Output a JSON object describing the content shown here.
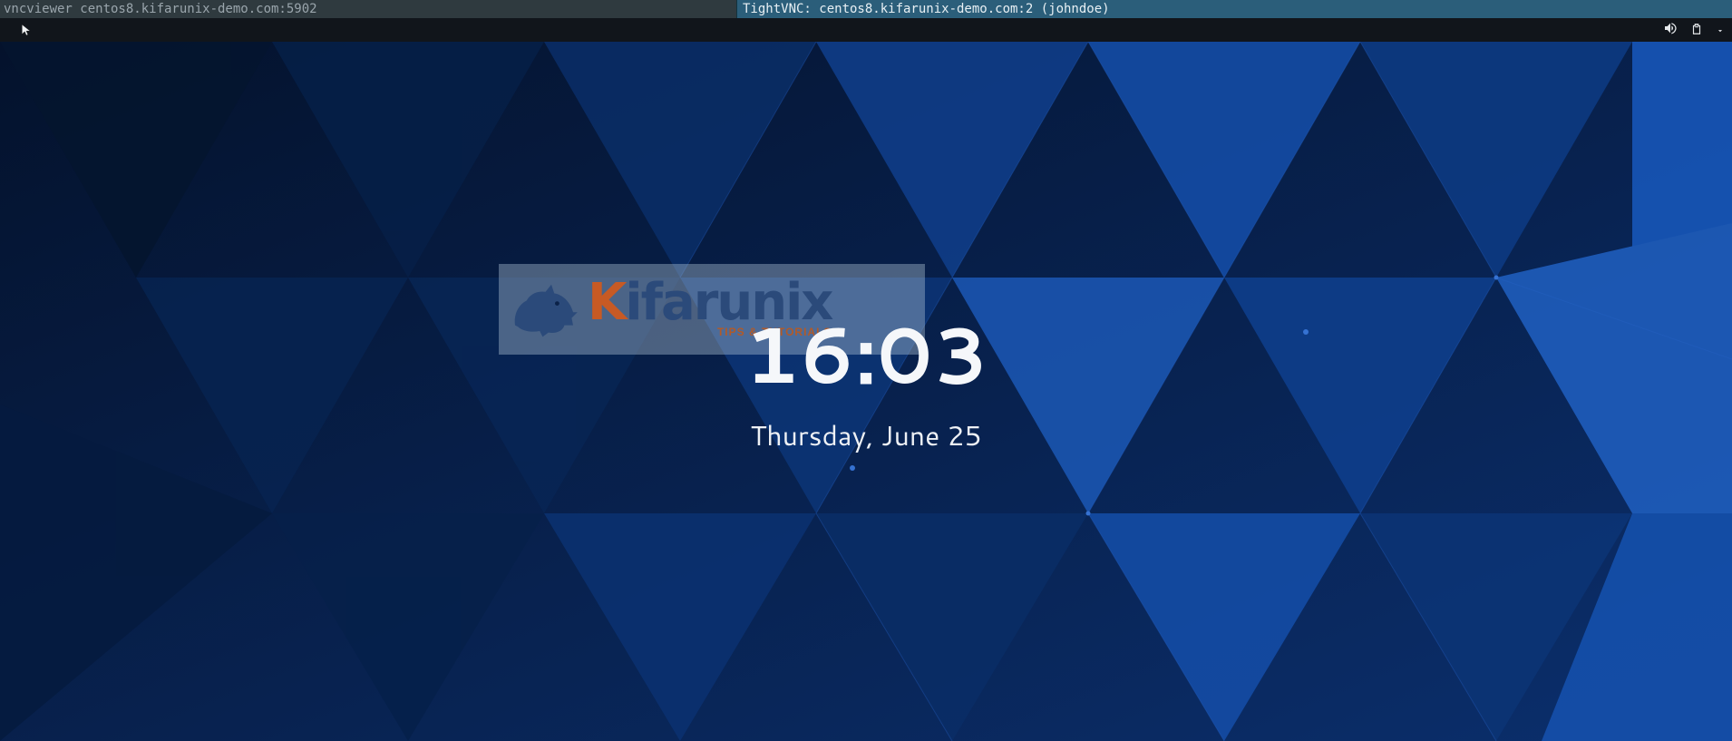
{
  "titlebar": {
    "left_title": "vncviewer centos8.kifarunix-demo.com:5902",
    "right_title": "TightVNC: centos8.kifarunix-demo.com:2 (johndoe)"
  },
  "topbar": {
    "icons": {
      "volume": "volume-icon",
      "power": "power-icon",
      "dropdown": "chevron-down-icon",
      "cursor": "cursor-icon"
    }
  },
  "watermark": {
    "brand_prefix": "K",
    "brand_rest": "ifarunix",
    "tagline": "TIPS & TUTORIALS"
  },
  "lockscreen": {
    "time": "16:03",
    "date": "Thursday, June 25"
  },
  "colors": {
    "wallpaper_dark": "#061b3c",
    "wallpaper_mid": "#0d3b82",
    "wallpaper_light": "#1a55b0",
    "accent_orange": "#c75a24"
  }
}
